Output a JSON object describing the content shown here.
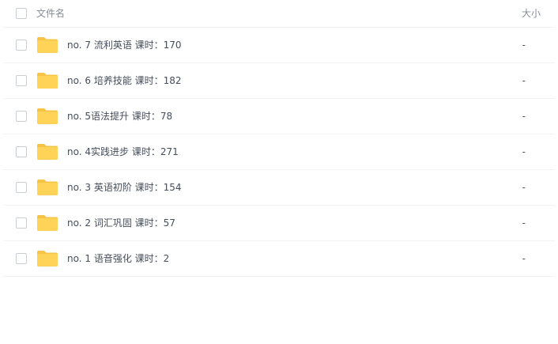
{
  "header": {
    "name_label": "文件名",
    "size_label": "大小"
  },
  "rows": [
    {
      "name": "no. 7 流利英语 课时：170",
      "size": "-"
    },
    {
      "name": "no. 6 培养技能 课时：182",
      "size": "-"
    },
    {
      "name": "no. 5语法提升 课时：78",
      "size": "-"
    },
    {
      "name": "no. 4实践进步 课时：271",
      "size": "-"
    },
    {
      "name": "no. 3 英语初阶 课时：154",
      "size": "-"
    },
    {
      "name": "no. 2 词汇巩固 课时：57",
      "size": "-"
    },
    {
      "name": "no. 1 语音强化 课时：2",
      "size": "-"
    }
  ],
  "icons": {
    "row_icon": "folder-icon",
    "folder_color": "#ffd358",
    "folder_tab_color": "#f7c344"
  }
}
